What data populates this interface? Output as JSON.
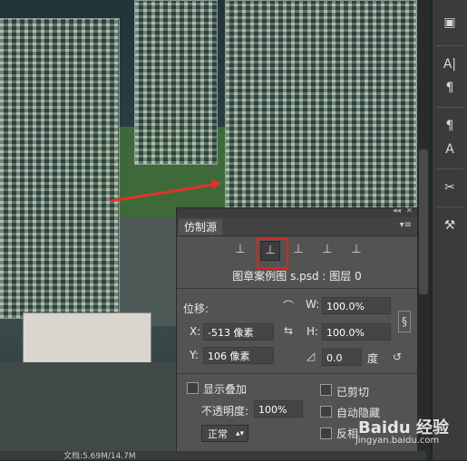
{
  "panel": {
    "tab_label": "仿制源",
    "menu_icon": "menu-icon",
    "source_buttons": [
      "clone-source-1-icon",
      "clone-source-2-icon",
      "clone-source-3-icon",
      "clone-source-4-icon",
      "clone-source-5-icon"
    ],
    "selected_source_index": 1,
    "source_file": "图章案例图 s.psd : 图层 0",
    "offset_label": "位移:",
    "x_label": "X:",
    "x_value": "-513 像素",
    "y_label": "Y:",
    "y_value": "106 像素",
    "w_label": "W:",
    "w_value": "100.0%",
    "h_label": "H:",
    "h_value": "100.0%",
    "angle_value": "0.0",
    "degree_label": "度",
    "show_overlay_label": "显示叠加",
    "opacity_label": "不透明度:",
    "opacity_value": "100%",
    "blend_mode": "正常",
    "clipped_label": "已剪切",
    "auto_hide_label": "自动隐藏",
    "invert_label": "反相"
  },
  "statusbar": {
    "doc_info": "文档:5.69M/14.7M"
  },
  "watermark": {
    "brand": "Baidu 经验",
    "url": "jingyan.baidu.com"
  },
  "colors": {
    "accent_red": "#e0231b",
    "panel_bg": "#535353"
  }
}
